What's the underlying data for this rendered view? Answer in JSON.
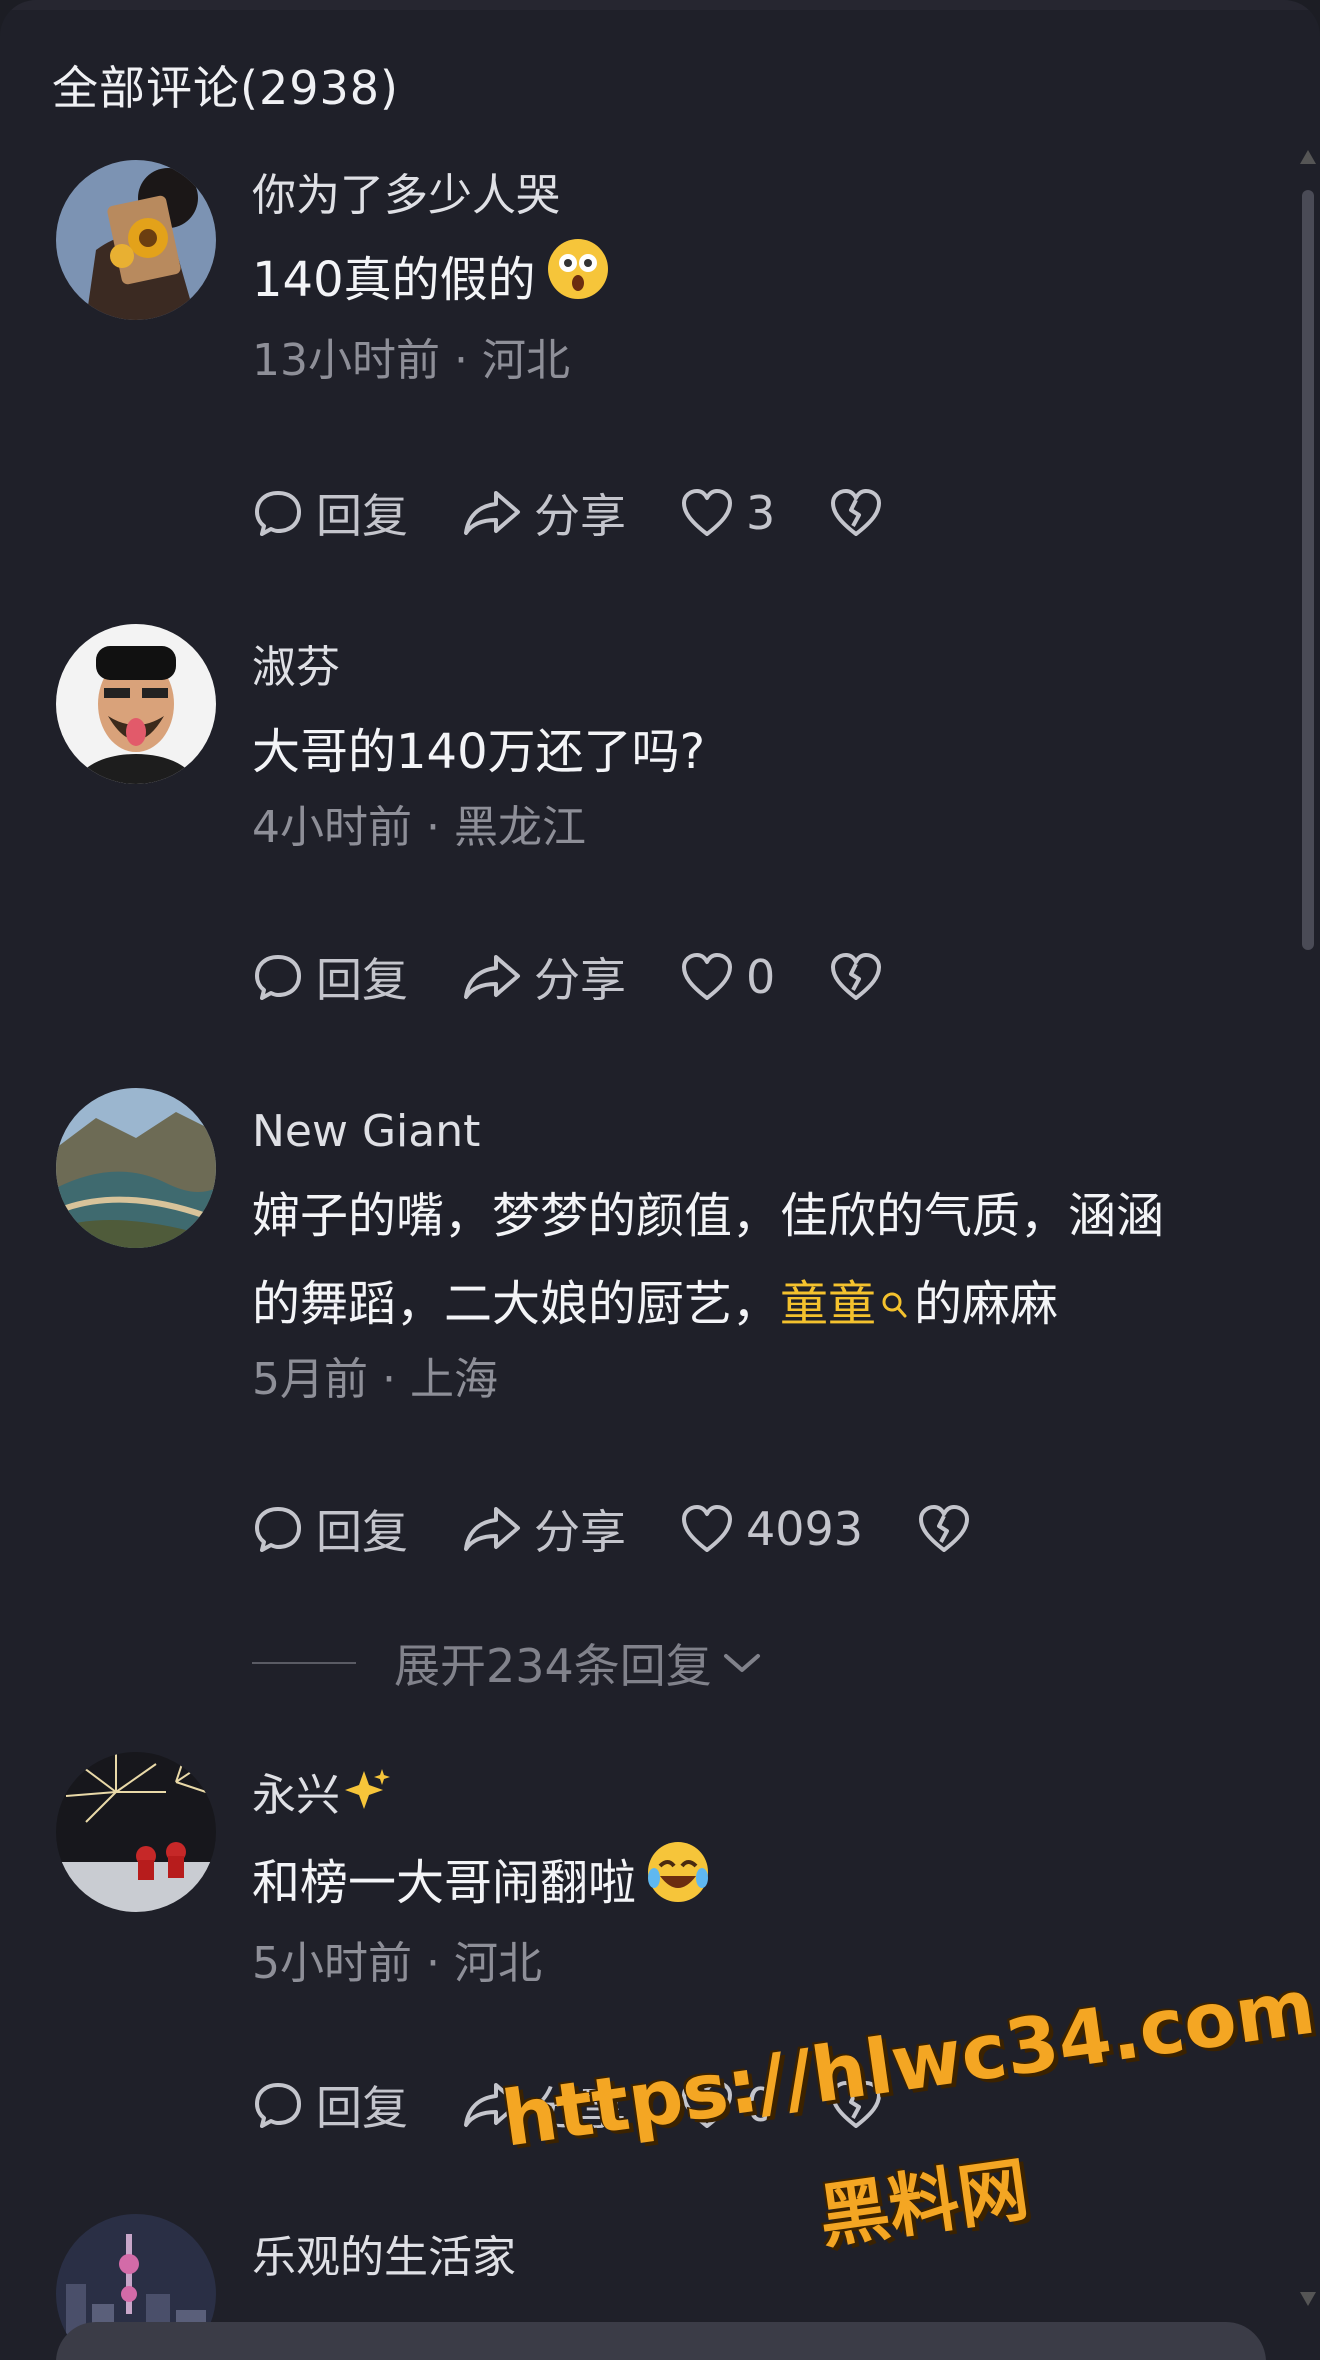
{
  "header": {
    "title": "全部评论(2938)"
  },
  "comments": [
    {
      "username": "你为了多少人哭",
      "text": "140真的假的",
      "emoji": "dizzy-face-emoji",
      "time": "13小时前 · 河北",
      "reply_label": "回复",
      "share_label": "分享",
      "likes": "3"
    },
    {
      "username": "淑芬",
      "text": "大哥的140万还了吗?",
      "time": "4小时前 · 黑龙江",
      "reply_label": "回复",
      "share_label": "分享",
      "likes": "0"
    },
    {
      "username": "New Giant",
      "text_line1": "婶子的嘴，梦梦的颜值，佳欣的气质，涵涵",
      "text_line2_a": "的舞蹈，二大娘的厨艺，",
      "text_highlight": "童童",
      "text_line2_b": "的麻麻",
      "time": "5月前 · 上海",
      "reply_label": "回复",
      "share_label": "分享",
      "likes": "4093",
      "expand_label": "展开234条回复"
    },
    {
      "username": "永兴",
      "username_emoji": "sparkles-emoji",
      "text": "和榜一大哥闹翻啦",
      "emoji": "laughing-tears-emoji",
      "time": "5小时前 · 河北",
      "reply_label": "回复",
      "share_label": "分享",
      "likes": "0"
    },
    {
      "username": "乐观的生活家"
    }
  ],
  "watermark": {
    "url": "https://hlwc34.com",
    "name": "黑料网"
  },
  "colors": {
    "background": "#1f2029",
    "highlight": "#f4c22e",
    "watermark": "#f4a623"
  }
}
